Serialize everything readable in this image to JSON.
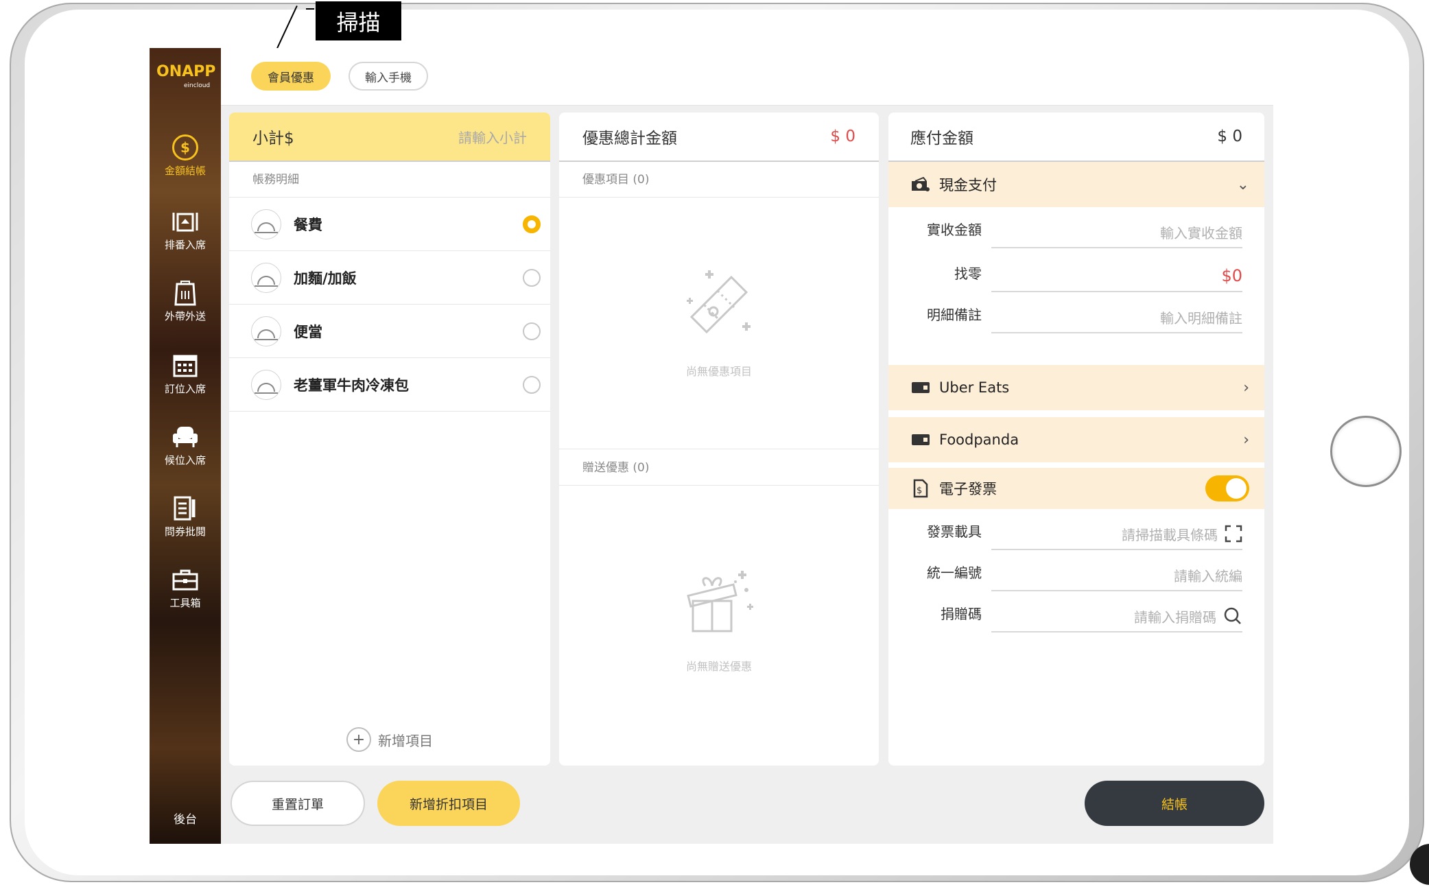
{
  "annotation": {
    "callout_label": "掃描"
  },
  "brand": {
    "logo_text": "ONAPP",
    "logo_sub": "eincloud"
  },
  "sidebar": {
    "items": [
      {
        "label": "金額結帳",
        "icon": "dollar-circle-icon",
        "active": true
      },
      {
        "label": "排番入席",
        "icon": "table-number-icon"
      },
      {
        "label": "外帶外送",
        "icon": "takeout-bag-icon"
      },
      {
        "label": "訂位入席",
        "icon": "calendar-icon"
      },
      {
        "label": "候位入席",
        "icon": "chair-icon"
      },
      {
        "label": "問券批閱",
        "icon": "survey-icon"
      },
      {
        "label": "工具箱",
        "icon": "toolbox-icon"
      }
    ],
    "backstage": "後台"
  },
  "topbar": {
    "tabs": [
      {
        "label": "會員優惠",
        "active": true
      },
      {
        "label": "輸入手機"
      }
    ]
  },
  "subtotal_panel": {
    "title": "小計$",
    "placeholder": "請輸入小計",
    "section": "帳務明細",
    "items": [
      {
        "label": "餐費",
        "selected": true
      },
      {
        "label": "加麵/加飯",
        "selected": false
      },
      {
        "label": "便當",
        "selected": false
      },
      {
        "label": "老薑軍牛肉冷凍包",
        "selected": false
      }
    ],
    "add_label": "新增項目"
  },
  "discount_panel": {
    "title": "優惠總計金額",
    "amount": "$ 0",
    "promo_section": "優惠項目 (0)",
    "promo_empty": "尚無優惠項目",
    "gift_section": "贈送優惠 (0)",
    "gift_empty": "尚無贈送優惠"
  },
  "payment_panel": {
    "title": "應付金額",
    "amount": "$ 0",
    "cash": {
      "label": "現金支付",
      "icon": "cash-icon"
    },
    "received": {
      "label": "實收金額",
      "placeholder": "輸入實收金額"
    },
    "change": {
      "label": "找零",
      "value": "$0"
    },
    "note": {
      "label": "明細備註",
      "placeholder": "輸入明細備註"
    },
    "uber": {
      "label": "Uber Eats"
    },
    "foodpanda": {
      "label": "Foodpanda"
    },
    "einvoice": {
      "label": "電子發票",
      "enabled": true
    },
    "carrier": {
      "label": "發票載具",
      "placeholder": "請掃描載具條碼"
    },
    "tax_id": {
      "label": "統一編號",
      "placeholder": "請輸入統編"
    },
    "donation": {
      "label": "捐贈碼",
      "placeholder": "請輸入捐贈碼"
    }
  },
  "footer": {
    "reset": "重置訂單",
    "add_discount": "新增折扣項目",
    "checkout": "結帳"
  },
  "colors": {
    "accent": "#f7b400",
    "highlight": "#fde58a",
    "dark_button": "#353a40",
    "negative": "#e04a4a"
  }
}
